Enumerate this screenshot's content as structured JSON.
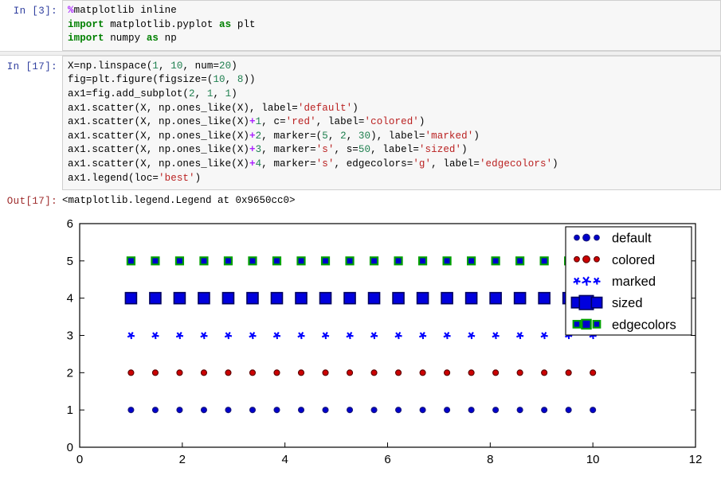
{
  "notebook": {
    "cells": [
      {
        "prompt": "In  [3]:",
        "lines": [
          "%matplotlib inline",
          "import matplotlib.pyplot as plt",
          "import numpy as np"
        ]
      },
      {
        "prompt": "In  [17]:",
        "lines": [
          "X=np.linspace(1, 10, num=20)",
          "fig=plt.figure(figsize=(10, 8))",
          "ax1=fig.add_subplot(2, 1, 1)",
          "ax1.scatter(X, np.ones_like(X), label='default')",
          "ax1.scatter(X, np.ones_like(X)+1, c='red', label='colored')",
          "ax1.scatter(X, np.ones_like(X)+2, marker=(5, 2, 30), label='marked')",
          "ax1.scatter(X, np.ones_like(X)+3, marker='s', s=50, label='sized')",
          "ax1.scatter(X, np.ones_like(X)+4, marker='s', edgecolors='g', label='edgecolors')",
          "ax1.legend(loc='best')"
        ]
      }
    ],
    "output": {
      "prompt": "Out[17]:",
      "text": "<matplotlib.legend.Legend at 0x9650cc0>"
    }
  },
  "chart_data": {
    "type": "scatter",
    "title": "",
    "xlabel": "",
    "ylabel": "",
    "xlim": [
      0,
      12
    ],
    "ylim": [
      0,
      6
    ],
    "xticks": [
      0,
      2,
      4,
      6,
      8,
      10,
      12
    ],
    "yticks": [
      0,
      1,
      2,
      3,
      4,
      5,
      6
    ],
    "xtick_labels": [
      "0",
      "2",
      "4",
      "6",
      "8",
      "10",
      "12"
    ],
    "ytick_labels": [
      "0",
      "1",
      "2",
      "3",
      "4",
      "5",
      "6"
    ],
    "grid": false,
    "legend_position": "upper right",
    "x": [
      1.0,
      1.4737,
      1.9474,
      2.4211,
      2.8947,
      3.3684,
      3.8421,
      4.3158,
      4.7895,
      5.2632,
      5.7368,
      6.2105,
      6.6842,
      7.1579,
      7.6316,
      8.1053,
      8.5789,
      9.0526,
      9.5263,
      10.0
    ],
    "series": [
      {
        "name": "default",
        "y_value": 1,
        "marker": "circle",
        "face_color": "#0000CC",
        "edge_color": "#1a1a7a",
        "size": 7
      },
      {
        "name": "colored",
        "y_value": 2,
        "marker": "circle",
        "face_color": "#CC0000",
        "edge_color": "#5a0000",
        "size": 7
      },
      {
        "name": "marked",
        "y_value": 3,
        "marker": "asterisk-5",
        "face_color": "#0000FF",
        "edge_color": "#0000FF",
        "size": 8
      },
      {
        "name": "sized",
        "y_value": 4,
        "marker": "square",
        "face_color": "#0000DD",
        "edge_color": "#000060",
        "size": 14
      },
      {
        "name": "edgecolors",
        "y_value": 5,
        "marker": "square",
        "face_color": "#0000CC",
        "edge_color": "#00A000",
        "size": 9
      }
    ]
  }
}
